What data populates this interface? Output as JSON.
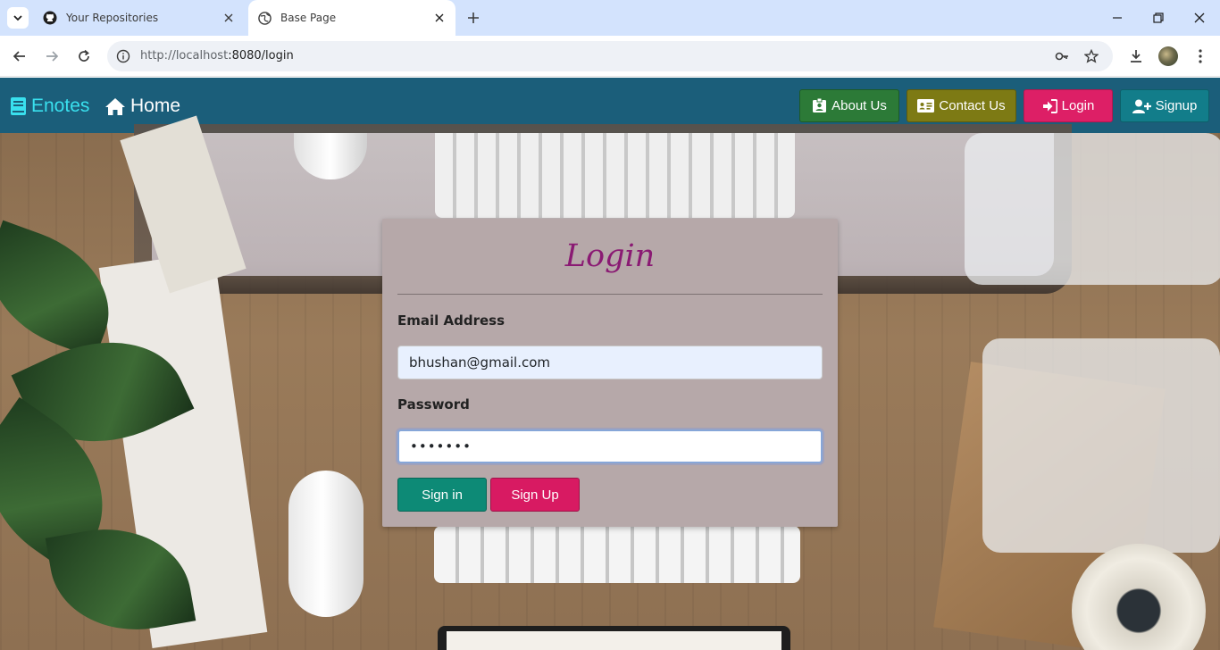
{
  "browser": {
    "tabs": [
      {
        "title": "Your Repositories",
        "active": false,
        "favicon": "github-icon"
      },
      {
        "title": "Base Page",
        "active": true,
        "favicon": "globe-icon"
      }
    ],
    "url_host": "http://localhost",
    "url_rest": ":8080/login"
  },
  "navbar": {
    "brand": "Enotes",
    "home": "Home",
    "buttons": {
      "about": "About Us",
      "contact": "Contact Us",
      "login": "Login",
      "signup": "Signup"
    },
    "colors": {
      "bar": "#1b5e7a",
      "brand": "#39e0ee",
      "about": "#2c7a37",
      "contact": "#7d7a14",
      "login": "#dd1f66",
      "signup": "#127d8a"
    }
  },
  "login_card": {
    "title": "Login",
    "email_label": "Email Address",
    "email_value": "bhushan@gmail.com",
    "password_label": "Password",
    "password_value": "•••••••",
    "signin_label": "Sign in",
    "signup_label": "Sign Up",
    "colors": {
      "card": "#b6a8a9",
      "title": "#8a1a73",
      "signin": "#0d8a76",
      "signup": "#d81a62"
    }
  }
}
